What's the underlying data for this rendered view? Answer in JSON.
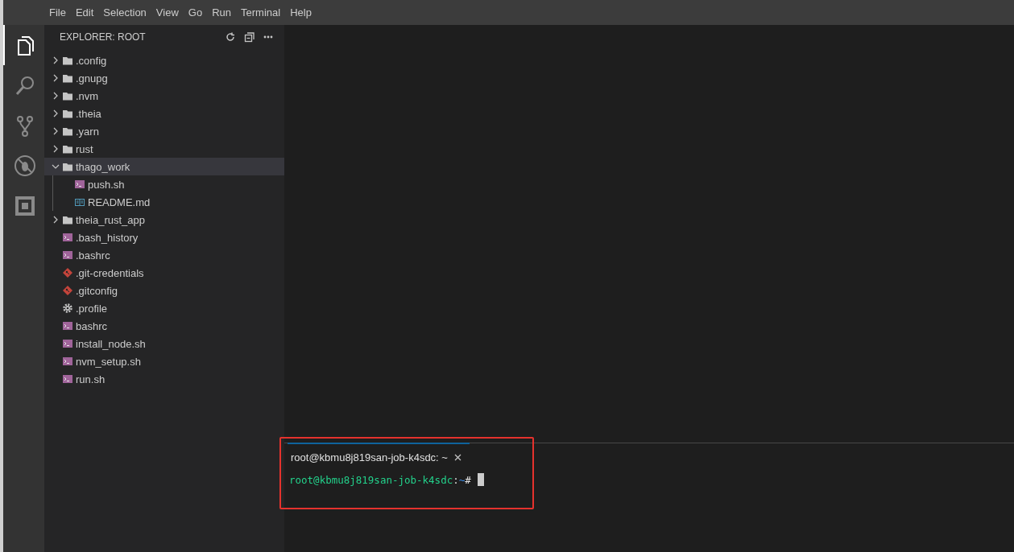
{
  "menu_bar": [
    "File",
    "Edit",
    "Selection",
    "View",
    "Go",
    "Run",
    "Terminal",
    "Help"
  ],
  "activity_bar": [
    {
      "kind": "files",
      "selected": true
    },
    {
      "kind": "search",
      "selected": false
    },
    {
      "kind": "source-control",
      "selected": false
    },
    {
      "kind": "debug",
      "selected": false
    },
    {
      "kind": "extensions",
      "selected": false
    }
  ],
  "explorer": {
    "title": "EXPLORER: ROOT",
    "items": [
      {
        "label": ".config",
        "kind": "folder",
        "expanded": false,
        "selected": false
      },
      {
        "label": ".gnupg",
        "kind": "folder",
        "expanded": false,
        "selected": false
      },
      {
        "label": ".nvm",
        "kind": "folder",
        "expanded": false,
        "selected": false
      },
      {
        "label": ".theia",
        "kind": "folder",
        "expanded": false,
        "selected": false
      },
      {
        "label": ".yarn",
        "kind": "folder",
        "expanded": false,
        "selected": false
      },
      {
        "label": "rust",
        "kind": "folder",
        "expanded": false,
        "selected": false
      },
      {
        "label": "thago_work",
        "kind": "folder",
        "expanded": true,
        "selected": true,
        "children": [
          {
            "label": "push.sh",
            "kind": "shell",
            "selected": false
          },
          {
            "label": "README.md",
            "kind": "markdown",
            "selected": false
          }
        ]
      },
      {
        "label": "theia_rust_app",
        "kind": "folder",
        "expanded": false,
        "selected": false
      },
      {
        "label": ".bash_history",
        "kind": "shell",
        "selected": false
      },
      {
        "label": ".bashrc",
        "kind": "shell",
        "selected": false
      },
      {
        "label": ".git-credentials",
        "kind": "git",
        "selected": false
      },
      {
        "label": ".gitconfig",
        "kind": "git",
        "selected": false
      },
      {
        "label": ".profile",
        "kind": "settings",
        "selected": false
      },
      {
        "label": "bashrc",
        "kind": "shell",
        "selected": false
      },
      {
        "label": "install_node.sh",
        "kind": "shell",
        "selected": false
      },
      {
        "label": "nvm_setup.sh",
        "kind": "shell",
        "selected": false
      },
      {
        "label": "run.sh",
        "kind": "shell",
        "selected": false
      }
    ]
  },
  "terminal": {
    "tabs": [
      {
        "label": "root@kbmu8j819san-job-k4sdc: ~",
        "selected": true
      }
    ],
    "prompt": {
      "user_host": "root@kbmu8j819san-job-k4sdc",
      "separator": ":",
      "path": "~",
      "symbol": "#"
    }
  }
}
